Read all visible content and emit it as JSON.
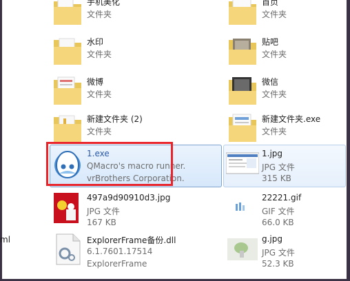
{
  "items": [
    {
      "name": "手机美化",
      "l2": "文件夹"
    },
    {
      "name": "首页",
      "l2": "文件夹"
    },
    {
      "name": "水印",
      "l2": "文件夹"
    },
    {
      "name": "贴吧",
      "l2": "文件夹"
    },
    {
      "name": "微博",
      "l2": "文件夹"
    },
    {
      "name": "微信",
      "l2": "文件夹"
    },
    {
      "name": "新建文件夹 (2)",
      "l2": "文件夹"
    },
    {
      "name": "新建文件夹.exe",
      "l2": "文件夹"
    },
    {
      "name": "1.exe",
      "l2": "QMacro's macro runner.",
      "l3": "vrBrothers Corporation."
    },
    {
      "name": "1.jpg",
      "l2": "JPG 文件",
      "l3": "315 KB"
    },
    {
      "name": "497a9d90910d3.jpg",
      "l2": "JPG 文件",
      "l3": "167 KB"
    },
    {
      "name": "22221.gif",
      "l2": "GIF 文件",
      "l3": "66.0 KB"
    },
    {
      "name": "ExplorerFrame备份.dll",
      "l2": "6.1.7601.17514",
      "l3": "ExplorerFrame"
    },
    {
      "name": "g.jpg",
      "l2": "JPG 文件",
      "l3": "52.3 KB"
    }
  ],
  "cutoff_label": "ml",
  "colors": {
    "selection_border": "#7da2ce",
    "highlight_box": "#e8232a",
    "frame": "#3c3246"
  }
}
